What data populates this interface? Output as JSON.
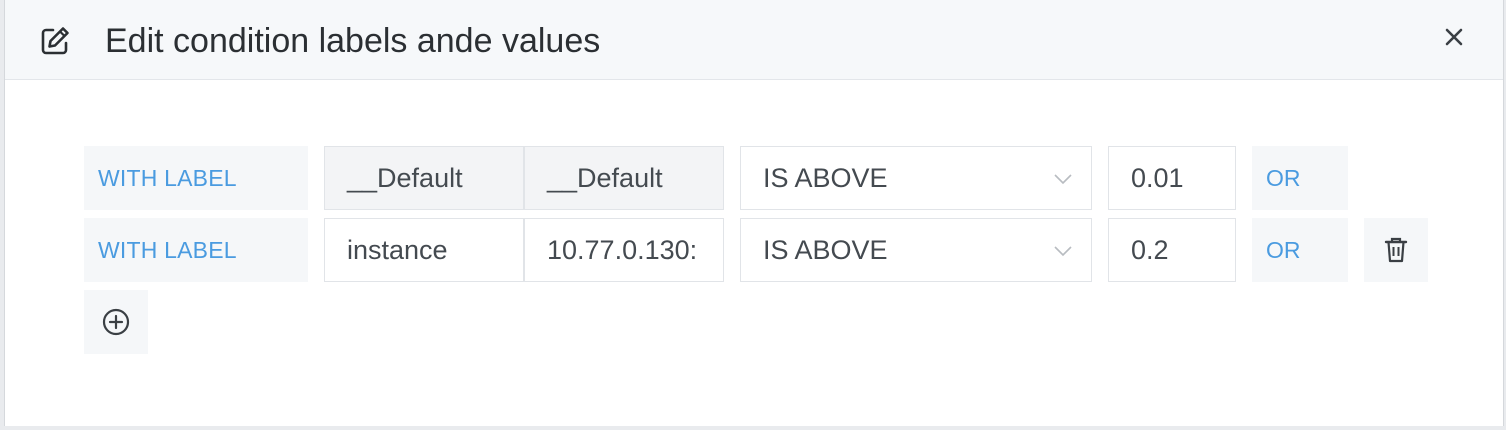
{
  "dialog": {
    "title": "Edit condition labels ande values",
    "edit_icon": "edit-icon",
    "close_icon": "close-icon"
  },
  "conditions": [
    {
      "with_label": "WITH LABEL",
      "label_name": "__Default",
      "label_value": "__Default",
      "operator": "IS ABOVE",
      "threshold": "0.01",
      "or_label": "OR",
      "deletable": false
    },
    {
      "with_label": "WITH LABEL",
      "label_name": "instance",
      "label_value": "10.77.0.130:",
      "operator": "IS ABOVE",
      "threshold": "0.2",
      "or_label": "OR",
      "deletable": true
    }
  ],
  "add_condition_icon": "plus-circle-icon",
  "delete_icon": "trash-icon",
  "colors": {
    "accent": "#4a9be0",
    "header_bg": "#f6f8fa",
    "text": "#2b2f33"
  }
}
